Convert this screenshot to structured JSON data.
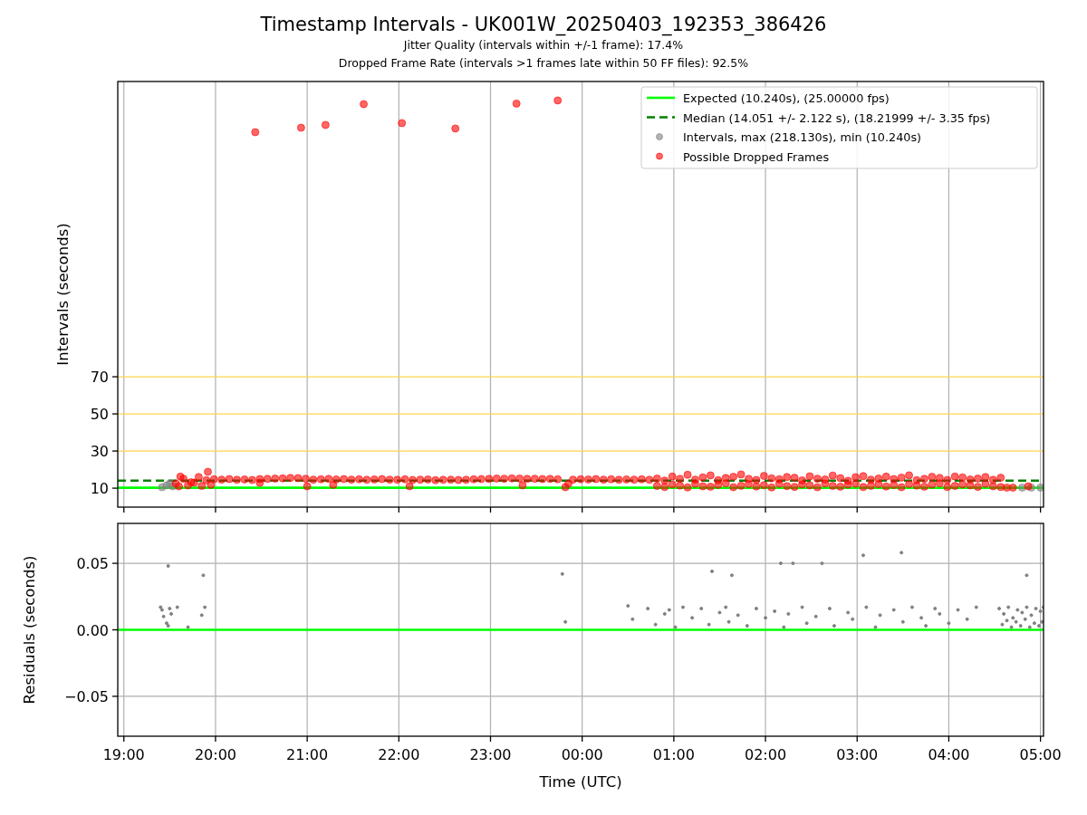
{
  "title": "Timestamp Intervals - UK001W_20250403_192353_386426",
  "subtitles": [
    "Jitter Quality (intervals within +/-1 frame): 17.4%",
    "Dropped Frame Rate (intervals >1 frames late within 50 FF files): 92.5%"
  ],
  "intervals_plot": {
    "chart_data": {
      "type": "scatter",
      "ylabel": "Intervals (seconds)",
      "xlim": [
        "2025-04-03T18:56",
        "2025-04-04T05:02"
      ],
      "ylim": [
        -0.2,
        229
      ],
      "grid": true,
      "legend": true,
      "yticks": [
        {
          "value": 10,
          "label": "10"
        },
        {
          "value": 30,
          "label": "30"
        },
        {
          "value": 50,
          "label": "50"
        },
        {
          "value": 70,
          "label": "70"
        }
      ],
      "ref_lines": [
        {
          "axis": "y",
          "value": 10.24,
          "label": "Expected (10.240s), (25.00000 fps)",
          "color": "#00ff00"
        },
        {
          "axis": "y",
          "value": 14.051,
          "label": "Median (14.051 +/- 2.122 s), (18.21999 +/- 3.35 fps)",
          "color": "#008000"
        }
      ],
      "series": [
        {
          "name": "Intervals, max (218.130s), min (10.240s)",
          "color": "#808080",
          "x": [
            "2025-04-03T19:25",
            "2025-04-03T19:28",
            "2025-04-03T19:30",
            "2025-04-03T19:32",
            "2025-04-04T04:48",
            "2025-04-04T04:54",
            "2025-04-04T05:00"
          ],
          "values": [
            10.5,
            11.5,
            12.5,
            11.0,
            10.3,
            10.3,
            10.3
          ]
        },
        {
          "name": "Possible Dropped Frames",
          "color": "#ff0000",
          "x": [
            "2025-04-03T20:26",
            "2025-04-03T20:56",
            "2025-04-03T21:12",
            "2025-04-03T21:37",
            "2025-04-03T22:02",
            "2025-04-03T22:37",
            "2025-04-03T23:17",
            "2025-04-03T23:44",
            "2025-04-03T19:36",
            "2025-04-03T19:37",
            "2025-04-03T19:42",
            "2025-04-03T19:46",
            "2025-04-03T19:51",
            "2025-04-03T19:55",
            "2025-04-03T19:57",
            "2025-04-03T20:29",
            "2025-04-03T21:00",
            "2025-04-03T21:17",
            "2025-04-03T22:07",
            "2025-04-03T23:21",
            "2025-04-04T04:52",
            "2025-04-03T23:49",
            "2025-04-03T23:51",
            "2025-04-03T19:34",
            "2025-04-03T19:39",
            "2025-04-03T19:44",
            "2025-04-03T19:49",
            "2025-04-03T19:54",
            "2025-04-03T19:59",
            "2025-04-03T20:04",
            "2025-04-03T20:09",
            "2025-04-03T20:14",
            "2025-04-03T20:19",
            "2025-04-03T20:24",
            "2025-04-03T20:29",
            "2025-04-03T20:34",
            "2025-04-03T20:39",
            "2025-04-03T20:44",
            "2025-04-03T20:49",
            "2025-04-03T20:54",
            "2025-04-03T20:59",
            "2025-04-03T21:04",
            "2025-04-03T21:09",
            "2025-04-03T21:14",
            "2025-04-03T21:19",
            "2025-04-03T21:24",
            "2025-04-03T21:29",
            "2025-04-03T21:34",
            "2025-04-03T21:39",
            "2025-04-03T21:44",
            "2025-04-03T21:49",
            "2025-04-03T21:54",
            "2025-04-03T21:59",
            "2025-04-03T22:04",
            "2025-04-03T22:09",
            "2025-04-03T22:14",
            "2025-04-03T22:19",
            "2025-04-03T22:24",
            "2025-04-03T22:29",
            "2025-04-03T22:34",
            "2025-04-03T22:39",
            "2025-04-03T22:44",
            "2025-04-03T22:49",
            "2025-04-03T22:54",
            "2025-04-03T22:59",
            "2025-04-03T23:04",
            "2025-04-03T23:09",
            "2025-04-03T23:14",
            "2025-04-03T23:19",
            "2025-04-03T23:24",
            "2025-04-03T23:29",
            "2025-04-03T23:34",
            "2025-04-03T23:39",
            "2025-04-03T23:44",
            "2025-04-03T23:54",
            "2025-04-03T23:59",
            "2025-04-04T00:04",
            "2025-04-04T00:09",
            "2025-04-04T00:14",
            "2025-04-04T00:19",
            "2025-04-04T00:24",
            "2025-04-04T00:29",
            "2025-04-04T00:34",
            "2025-04-04T00:39",
            "2025-04-04T00:44",
            "2025-04-04T00:49",
            "2025-04-04T00:54",
            "2025-04-04T00:59",
            "2025-04-04T01:04",
            "2025-04-04T01:09",
            "2025-04-04T01:14",
            "2025-04-04T01:19",
            "2025-04-04T01:24",
            "2025-04-04T01:29",
            "2025-04-04T01:34",
            "2025-04-04T01:39",
            "2025-04-04T01:44",
            "2025-04-04T01:49",
            "2025-04-04T01:54",
            "2025-04-04T01:59",
            "2025-04-04T02:04",
            "2025-04-04T02:09",
            "2025-04-04T02:14",
            "2025-04-04T02:19",
            "2025-04-04T02:24",
            "2025-04-04T02:29",
            "2025-04-04T02:34",
            "2025-04-04T02:39",
            "2025-04-04T02:44",
            "2025-04-04T02:49",
            "2025-04-04T02:54",
            "2025-04-04T02:59",
            "2025-04-04T03:04",
            "2025-04-04T03:09",
            "2025-04-04T03:14",
            "2025-04-04T03:19",
            "2025-04-04T03:24",
            "2025-04-04T03:29",
            "2025-04-04T03:34",
            "2025-04-04T03:39",
            "2025-04-04T03:44",
            "2025-04-04T03:49",
            "2025-04-04T03:54",
            "2025-04-04T03:59",
            "2025-04-04T04:04",
            "2025-04-04T04:09",
            "2025-04-04T04:14",
            "2025-04-04T04:19",
            "2025-04-04T04:24",
            "2025-04-04T04:29",
            "2025-04-04T04:34",
            "2025-04-04T00:49",
            "2025-04-04T00:54",
            "2025-04-04T00:59",
            "2025-04-04T01:04",
            "2025-04-04T01:09",
            "2025-04-04T01:14",
            "2025-04-04T01:19",
            "2025-04-04T01:24",
            "2025-04-04T01:29",
            "2025-04-04T01:34",
            "2025-04-04T01:39",
            "2025-04-04T01:44",
            "2025-04-04T01:49",
            "2025-04-04T01:54",
            "2025-04-04T01:59",
            "2025-04-04T02:04",
            "2025-04-04T02:09",
            "2025-04-04T02:14",
            "2025-04-04T02:19",
            "2025-04-04T02:24",
            "2025-04-04T02:29",
            "2025-04-04T02:34",
            "2025-04-04T02:39",
            "2025-04-04T02:44",
            "2025-04-04T02:49",
            "2025-04-04T02:54",
            "2025-04-04T02:59",
            "2025-04-04T03:04",
            "2025-04-04T03:09",
            "2025-04-04T03:14",
            "2025-04-04T03:19",
            "2025-04-04T03:24",
            "2025-04-04T03:29",
            "2025-04-04T03:34",
            "2025-04-04T03:39",
            "2025-04-04T03:44",
            "2025-04-04T03:49",
            "2025-04-04T03:54",
            "2025-04-04T03:59",
            "2025-04-04T04:04",
            "2025-04-04T04:09",
            "2025-04-04T04:14",
            "2025-04-04T04:19",
            "2025-04-04T04:24",
            "2025-04-04T04:29",
            "2025-04-04T04:34",
            "2025-04-04T04:38",
            "2025-04-04T04:42"
          ],
          "values": [
            201.7,
            204.1,
            205.6,
            216.8,
            206.6,
            203.7,
            217.1,
            218.8,
            11.0,
            16.2,
            11.5,
            13.0,
            11.2,
            18.8,
            11.8,
            12.9,
            11.0,
            11.8,
            11.0,
            11.5,
            11.0,
            10.5,
            12.5,
            12.5,
            15.1,
            13.2,
            16.0,
            14.3,
            14.8,
            14.6,
            14.9,
            14.5,
            14.7,
            14.4,
            14.9,
            15.0,
            15.2,
            15.3,
            15.5,
            15.4,
            15.1,
            14.6,
            14.8,
            15.0,
            14.7,
            14.9,
            14.6,
            14.8,
            14.5,
            14.7,
            14.9,
            14.6,
            14.5,
            14.8,
            14.4,
            14.6,
            14.7,
            14.3,
            14.5,
            14.6,
            14.4,
            14.5,
            14.8,
            14.9,
            15.0,
            15.2,
            15.1,
            15.3,
            15.2,
            15.0,
            15.1,
            14.9,
            15.0,
            14.8,
            14.6,
            14.8,
            14.7,
            14.9,
            14.6,
            14.8,
            14.5,
            14.7,
            14.6,
            14.8,
            14.5,
            15.2,
            14.1,
            16.3,
            15.0,
            17.2,
            14.6,
            15.8,
            16.9,
            14.3,
            15.5,
            16.1,
            17.4,
            15.0,
            14.4,
            16.6,
            15.3,
            14.8,
            16.0,
            15.6,
            14.2,
            16.4,
            15.1,
            14.7,
            16.8,
            15.4,
            14.0,
            15.9,
            16.5,
            14.6,
            15.2,
            16.2,
            14.9,
            15.7,
            16.9,
            14.3,
            15.0,
            16.1,
            15.5,
            14.4,
            16.3,
            15.8,
            14.7,
            15.2,
            16.0,
            14.5,
            15.6,
            11.2,
            10.6,
            12.0,
            11.4,
            10.4,
            12.4,
            11.0,
            10.8,
            11.8,
            12.6,
            10.5,
            11.3,
            12.2,
            10.9,
            11.6,
            10.4,
            12.3,
            11.1,
            10.7,
            12.0,
            11.5,
            10.5,
            12.5,
            11.2,
            10.8,
            11.9,
            12.4,
            10.6,
            11.3,
            12.1,
            10.9,
            11.7,
            10.5,
            12.2,
            11.4,
            10.8,
            11.9,
            12.6,
            10.6,
            11.2,
            12.0,
            11.5,
            10.7,
            12.3,
            11.0,
            10.6,
            10.3,
            10.3
          ]
        }
      ]
    }
  },
  "residuals_plot": {
    "chart_data": {
      "type": "scatter",
      "xlabel": "Time (UTC)",
      "ylabel": "Residuals (seconds)",
      "xlim": [
        "2025-04-03T18:56",
        "2025-04-04T05:02"
      ],
      "ylim": [
        -0.08,
        0.08
      ],
      "grid": true,
      "xticks": [
        {
          "value": "2025-04-03T19:00",
          "label": "19:00"
        },
        {
          "value": "2025-04-03T20:00",
          "label": "20:00"
        },
        {
          "value": "2025-04-03T21:00",
          "label": "21:00"
        },
        {
          "value": "2025-04-03T22:00",
          "label": "22:00"
        },
        {
          "value": "2025-04-03T23:00",
          "label": "23:00"
        },
        {
          "value": "2025-04-04T00:00",
          "label": "00:00"
        },
        {
          "value": "2025-04-04T01:00",
          "label": "01:00"
        },
        {
          "value": "2025-04-04T02:00",
          "label": "02:00"
        },
        {
          "value": "2025-04-04T03:00",
          "label": "03:00"
        },
        {
          "value": "2025-04-04T04:00",
          "label": "04:00"
        },
        {
          "value": "2025-04-04T05:00",
          "label": "05:00"
        }
      ],
      "yticks": [
        {
          "value": -0.05,
          "label": "−0.05"
        },
        {
          "value": 0,
          "label": "0.00"
        },
        {
          "value": 0.05,
          "label": "0.05"
        }
      ],
      "ref_lines": [
        {
          "axis": "y",
          "value": 0,
          "color": "#00ff00"
        }
      ],
      "series": [
        {
          "color": "#808080",
          "x": [
            "2025-04-03T19:29",
            "2025-04-03T19:52",
            "2025-04-03T19:24",
            "2025-04-03T19:25",
            "2025-04-03T19:26",
            "2025-04-03T19:28",
            "2025-04-03T19:29",
            "2025-04-03T19:30",
            "2025-04-03T19:31",
            "2025-04-03T19:35",
            "2025-04-03T19:53",
            "2025-04-03T19:42",
            "2025-04-03T19:51",
            "2025-04-03T23:47",
            "2025-04-03T23:49",
            "2025-04-04T01:25",
            "2025-04-04T01:38",
            "2025-04-04T02:10",
            "2025-04-04T02:18",
            "2025-04-04T02:37",
            "2025-04-04T03:04",
            "2025-04-04T03:29",
            "2025-04-04T04:51",
            "2025-04-04T00:30",
            "2025-04-04T00:33",
            "2025-04-04T00:43",
            "2025-04-04T00:48",
            "2025-04-04T00:54",
            "2025-04-04T00:57",
            "2025-04-04T01:01",
            "2025-04-04T01:06",
            "2025-04-04T01:12",
            "2025-04-04T01:18",
            "2025-04-04T01:23",
            "2025-04-04T01:30",
            "2025-04-04T01:34",
            "2025-04-04T01:36",
            "2025-04-04T01:42",
            "2025-04-04T01:48",
            "2025-04-04T01:54",
            "2025-04-04T02:00",
            "2025-04-04T02:06",
            "2025-04-04T02:12",
            "2025-04-04T02:15",
            "2025-04-04T02:24",
            "2025-04-04T02:27",
            "2025-04-04T02:33",
            "2025-04-04T02:42",
            "2025-04-04T02:45",
            "2025-04-04T02:54",
            "2025-04-04T02:57",
            "2025-04-04T03:06",
            "2025-04-04T03:12",
            "2025-04-04T03:15",
            "2025-04-04T03:24",
            "2025-04-04T03:30",
            "2025-04-04T03:36",
            "2025-04-04T03:42",
            "2025-04-04T03:45",
            "2025-04-04T03:51",
            "2025-04-04T03:54",
            "2025-04-04T04:00",
            "2025-04-04T04:06",
            "2025-04-04T04:12",
            "2025-04-04T04:18",
            "2025-04-04T04:33",
            "2025-04-04T04:36",
            "2025-04-04T04:39",
            "2025-04-04T04:42",
            "2025-04-04T04:45",
            "2025-04-04T04:48",
            "2025-04-04T04:51",
            "2025-04-04T04:54",
            "2025-04-04T04:57",
            "2025-04-04T05:00",
            "2025-04-04T05:02",
            "2025-04-04T04:35",
            "2025-04-04T04:38",
            "2025-04-04T04:41",
            "2025-04-04T04:44",
            "2025-04-04T04:47",
            "2025-04-04T04:50",
            "2025-04-04T04:53",
            "2025-04-04T04:56",
            "2025-04-04T04:59",
            "2025-04-04T05:01"
          ],
          "values": [
            0.048,
            0.041,
            0.017,
            0.015,
            0.01,
            0.005,
            0.003,
            0.016,
            0.012,
            0.017,
            0.017,
            0.002,
            0.011,
            0.042,
            0.006,
            0.044,
            0.041,
            0.05,
            0.05,
            0.05,
            0.056,
            0.058,
            0.041,
            0.018,
            0.008,
            0.016,
            0.004,
            0.012,
            0.015,
            0.002,
            0.017,
            0.009,
            0.016,
            0.004,
            0.013,
            0.017,
            0.006,
            0.011,
            0.003,
            0.016,
            0.009,
            0.014,
            0.002,
            0.012,
            0.017,
            0.005,
            0.01,
            0.016,
            0.003,
            0.013,
            0.008,
            0.017,
            0.002,
            0.011,
            0.015,
            0.006,
            0.017,
            0.009,
            0.003,
            0.016,
            0.012,
            0.005,
            0.015,
            0.008,
            0.017,
            0.016,
            0.012,
            0.017,
            0.009,
            0.015,
            0.013,
            0.017,
            0.011,
            0.016,
            0.014,
            0.017,
            0.004,
            0.007,
            0.002,
            0.006,
            0.003,
            0.008,
            0.002,
            0.005,
            0.003,
            0.006
          ]
        }
      ]
    }
  }
}
